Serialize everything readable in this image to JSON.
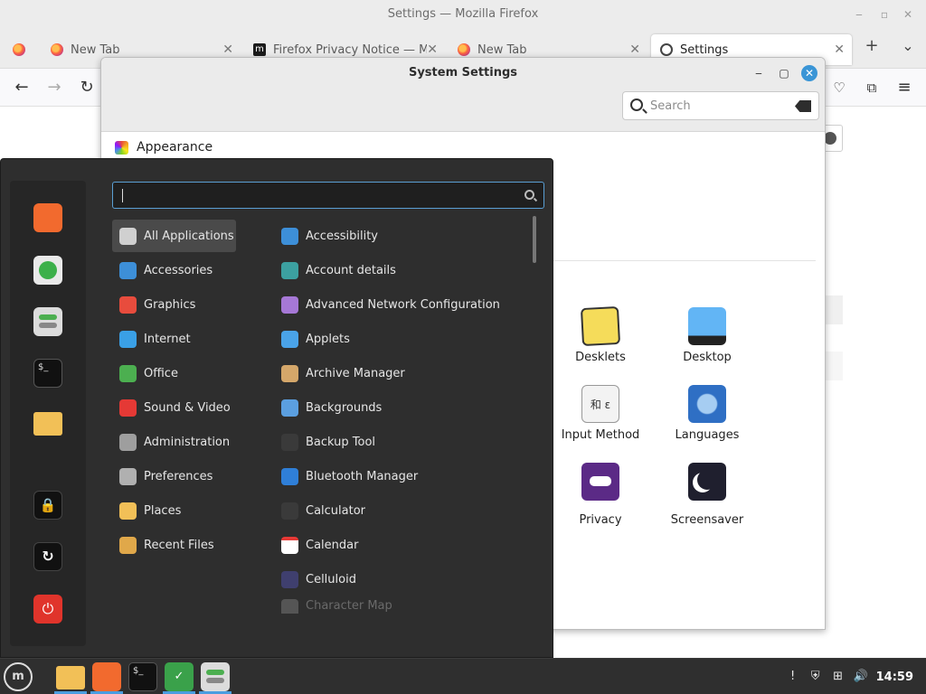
{
  "firefox": {
    "window_title": "Settings — Mozilla Firefox",
    "tabs": [
      {
        "label": "New Tab"
      },
      {
        "label": "Firefox Privacy Notice — M"
      },
      {
        "label": "New Tab"
      },
      {
        "label": "Settings"
      }
    ],
    "new_tab_symbol": "+",
    "list_tabs_symbol": "⌄"
  },
  "system_settings": {
    "title": "System Settings",
    "search_placeholder": "Search",
    "section": "Appearance",
    "tiles": [
      {
        "label": "Desklets",
        "icon": "desklets-icon"
      },
      {
        "label": "Desktop",
        "icon": "desktop-icon"
      },
      {
        "label": "Input Method",
        "icon": "input-method-icon",
        "glyphs": "和 ɛ"
      },
      {
        "label": "Languages",
        "icon": "languages-icon"
      },
      {
        "label": "Privacy",
        "icon": "privacy-icon"
      },
      {
        "label": "Screensaver",
        "icon": "screensaver-icon"
      }
    ]
  },
  "menu": {
    "search_value": "",
    "categories": [
      {
        "label": "All Applications",
        "icon": "grid-icon",
        "color": "#d0d0d0"
      },
      {
        "label": "Accessories",
        "icon": "scissors-icon",
        "color": "#3d8fd8"
      },
      {
        "label": "Graphics",
        "icon": "graphics-icon",
        "color": "#e84c3d"
      },
      {
        "label": "Internet",
        "icon": "cloud-icon",
        "color": "#3aa0e6"
      },
      {
        "label": "Office",
        "icon": "office-icon",
        "color": "#4caf50"
      },
      {
        "label": "Sound & Video",
        "icon": "play-icon",
        "color": "#e53935"
      },
      {
        "label": "Administration",
        "icon": "administration-icon",
        "color": "#9e9e9e"
      },
      {
        "label": "Preferences",
        "icon": "preferences-icon",
        "color": "#b0b0b0"
      },
      {
        "label": "Places",
        "icon": "folder-icon",
        "color": "#f2c057"
      },
      {
        "label": "Recent Files",
        "icon": "recent-folder-icon",
        "color": "#e0a84a"
      }
    ],
    "applications": [
      {
        "label": "Accessibility",
        "icon": "accessibility-icon",
        "color": "#3d8fd8"
      },
      {
        "label": "Account details",
        "icon": "account-icon",
        "color": "#3ca0a0"
      },
      {
        "label": "Advanced Network Configuration",
        "icon": "network-icon",
        "color": "#a678d6"
      },
      {
        "label": "Applets",
        "icon": "applets-icon",
        "color": "#4aa3e8"
      },
      {
        "label": "Archive Manager",
        "icon": "archive-icon",
        "color": "#d4a76a"
      },
      {
        "label": "Backgrounds",
        "icon": "backgrounds-icon",
        "color": "#5b9fe0"
      },
      {
        "label": "Backup Tool",
        "icon": "backup-icon",
        "color": "#3a3a3a"
      },
      {
        "label": "Bluetooth Manager",
        "icon": "bluetooth-icon",
        "color": "#2f7fd8"
      },
      {
        "label": "Calculator",
        "icon": "calculator-icon",
        "color": "#3a3a3a"
      },
      {
        "label": "Calendar",
        "icon": "calendar-icon",
        "color": "#ffffff"
      },
      {
        "label": "Celluloid",
        "icon": "celluloid-icon",
        "color": "#3f3f6e"
      },
      {
        "label": "Character Map",
        "icon": "character-map-icon",
        "color": "#555555"
      }
    ]
  },
  "taskbar": {
    "clock": "14:59"
  }
}
